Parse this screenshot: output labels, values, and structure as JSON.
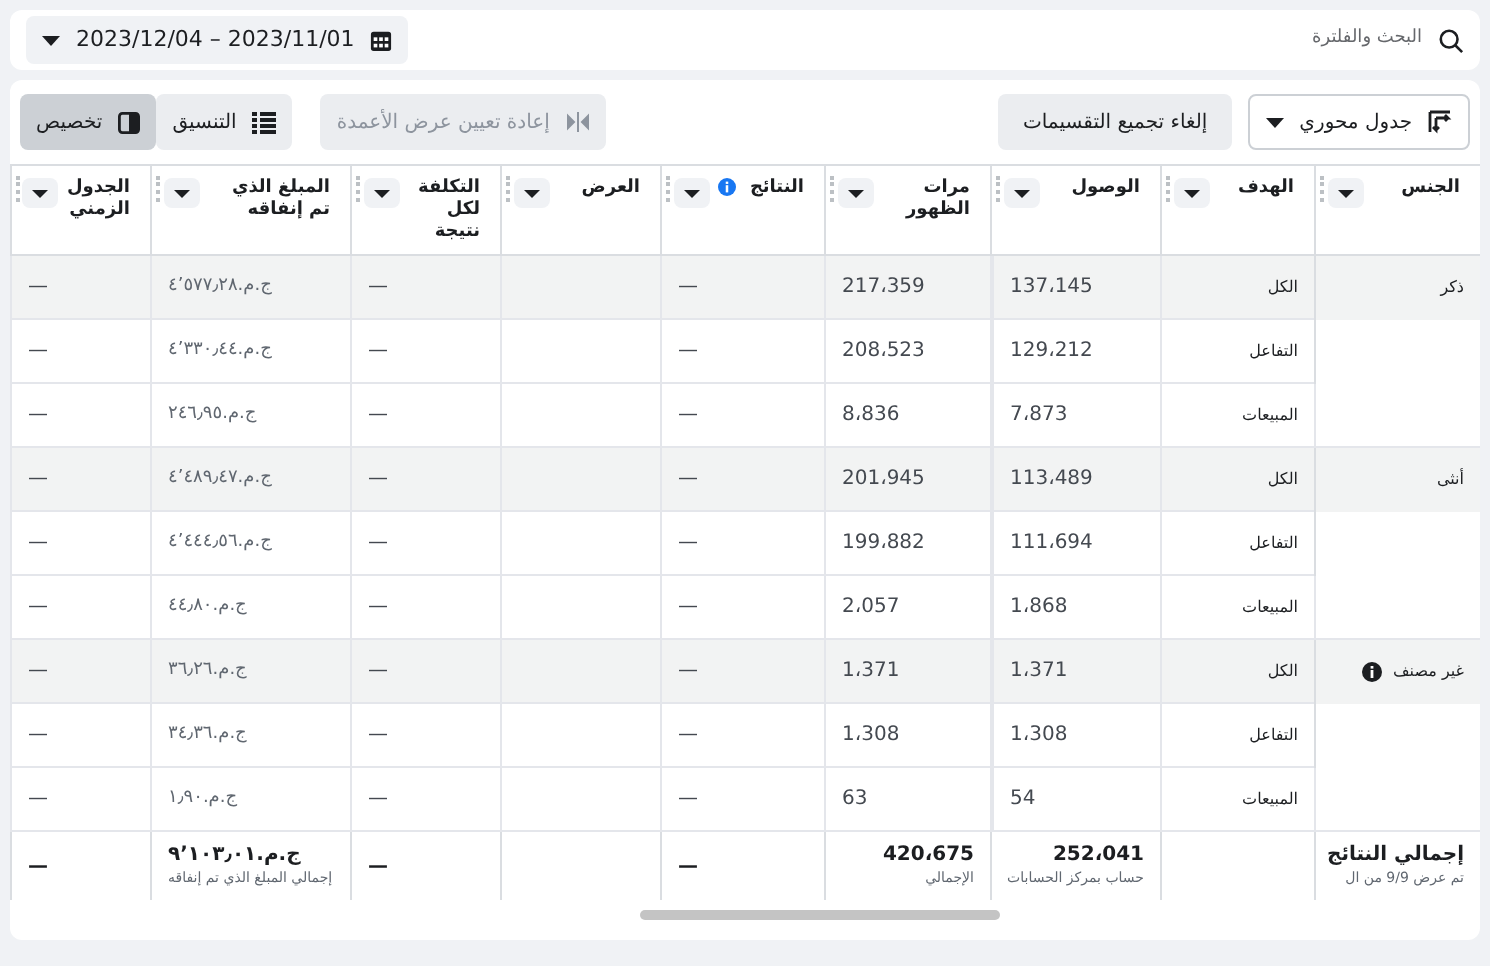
{
  "search": {
    "placeholder": "البحث والفلترة"
  },
  "date_range": {
    "value": "2023/12/04 – 2023/11/01"
  },
  "toolbar": {
    "pivot": {
      "label": "جدول محوري"
    },
    "ungroup": {
      "label": "إلغاء تجميع التقسيمات"
    },
    "buttons": [
      {
        "label": "إعادة تعيين عرض الأعمدة",
        "disabled": true,
        "selected": false
      },
      {
        "label": "التنسيق",
        "disabled": false,
        "selected": false
      },
      {
        "label": "تخصيص",
        "disabled": false,
        "selected": true
      }
    ]
  },
  "table": {
    "columns": [
      {
        "label": "الجنس",
        "info": false
      },
      {
        "label": "الهدف",
        "info": false
      },
      {
        "label": "الوصول",
        "info": false
      },
      {
        "label": "مرات الظهور",
        "info": false
      },
      {
        "label": "النتائج",
        "info": true
      },
      {
        "label": "العرض",
        "info": false
      },
      {
        "label": "التكلفة لكل نتيجة",
        "info": false
      },
      {
        "label": "المبلغ الذي تم إنفاقه",
        "info": false
      },
      {
        "label": "الجدول الزمني",
        "info": false
      }
    ],
    "rows": [
      {
        "cells": [
          "ذكر",
          "الكل",
          "137،145",
          "217،359",
          "—",
          "",
          "—",
          "ج.م.٤٬٥٧٧٫٢٨",
          "—"
        ]
      },
      {
        "cells": [
          "",
          "التفاعل",
          "129،212",
          "208،523",
          "—",
          "",
          "—",
          "ج.م.٤٬٣٣٠٫٤٤",
          "—"
        ]
      },
      {
        "cells": [
          "",
          "المبيعات",
          "7،873",
          "8،836",
          "—",
          "",
          "—",
          "ج.م.٢٤٦٫٩٥",
          "—"
        ]
      },
      {
        "cells": [
          "أنثى",
          "الكل",
          "113،489",
          "201،945",
          "—",
          "",
          "—",
          "ج.م.٤٬٤٨٩٫٤٧",
          "—"
        ]
      },
      {
        "cells": [
          "",
          "التفاعل",
          "111،694",
          "199،882",
          "—",
          "",
          "—",
          "ج.م.٤٬٤٤٤٫٥٦",
          "—"
        ]
      },
      {
        "cells": [
          "",
          "المبيعات",
          "1،868",
          "2،057",
          "—",
          "",
          "—",
          "ج.م.٤٤٫٨٠",
          "—"
        ]
      },
      {
        "gender_info": true,
        "cells": [
          "غير مصنف",
          "الكل",
          "1،371",
          "1،371",
          "—",
          "",
          "—",
          "ج.م.٣٦٫٢٦",
          "—"
        ]
      },
      {
        "cells": [
          "",
          "التفاعل",
          "1،308",
          "1،308",
          "—",
          "",
          "—",
          "ج.م.٣٤٫٣٦",
          "—"
        ]
      },
      {
        "cells": [
          "",
          "المبيعات",
          "54",
          "63",
          "—",
          "",
          "—",
          "ج.م.١٫٩٠",
          "—"
        ]
      }
    ],
    "totals": {
      "label": {
        "value": "إجمالي النتائج",
        "caption": "تم عرض 9/9 من ال"
      },
      "reach": {
        "value": "252،041",
        "caption": "حساب بمركز الحسابات"
      },
      "impressions": {
        "value": "420،675",
        "caption": "الإجمالي"
      },
      "results": {
        "value": "—"
      },
      "cost": {
        "value": "—"
      },
      "spent": {
        "value": "ج.م.٩٬١٠٣٫٠١",
        "caption": "إجمالي المبلغ الذي تم إنفاقه"
      },
      "schedule": {
        "value": "—"
      }
    }
  }
}
